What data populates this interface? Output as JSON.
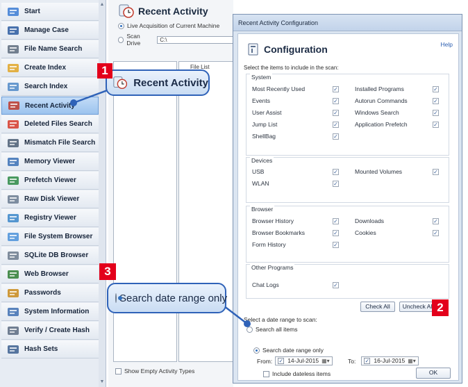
{
  "sidebar": {
    "items": [
      {
        "label": "Start",
        "icon": "start-icon"
      },
      {
        "label": "Manage Case",
        "icon": "case-icon"
      },
      {
        "label": "File Name Search",
        "icon": "binoculars-icon"
      },
      {
        "label": "Create Index",
        "icon": "index-icon"
      },
      {
        "label": "Search Index",
        "icon": "search-index-icon"
      },
      {
        "label": "Recent Activity",
        "icon": "recent-activity-icon"
      },
      {
        "label": "Deleted Files Search",
        "icon": "deleted-files-icon"
      },
      {
        "label": "Mismatch File Search",
        "icon": "mismatch-icon"
      },
      {
        "label": "Memory Viewer",
        "icon": "memory-icon"
      },
      {
        "label": "Prefetch Viewer",
        "icon": "prefetch-icon"
      },
      {
        "label": "Raw Disk Viewer",
        "icon": "disk-icon"
      },
      {
        "label": "Registry Viewer",
        "icon": "registry-icon"
      },
      {
        "label": "File System Browser",
        "icon": "folder-icon"
      },
      {
        "label": "SQLite DB Browser",
        "icon": "database-icon"
      },
      {
        "label": "Web Browser",
        "icon": "globe-icon"
      },
      {
        "label": "Passwords",
        "icon": "key-icon"
      },
      {
        "label": "System Information",
        "icon": "system-info-icon"
      },
      {
        "label": "Verify / Create Hash",
        "icon": "hash-icon"
      },
      {
        "label": "Hash Sets",
        "icon": "hash-sets-icon"
      }
    ],
    "active_index": 5
  },
  "main": {
    "title": "Recent Activity",
    "option_live": "Live Acquisition of Current Machine",
    "option_scan": "Scan Drive",
    "drive_value": "C:\\",
    "file_list_label": "File List",
    "show_empty_label": "Show Empty Activity Types"
  },
  "dialog": {
    "window_title": "Recent Activity Configuration",
    "heading": "Configuration",
    "help_link": "Help",
    "select_items_text": "Select the items to include in the scan:",
    "groups": {
      "system": {
        "label": "System",
        "left": [
          {
            "label": "Most Recently Used",
            "checked": true
          },
          {
            "label": "Events",
            "checked": true
          },
          {
            "label": "User Assist",
            "checked": true
          },
          {
            "label": "Jump List",
            "checked": true
          },
          {
            "label": "ShellBag",
            "checked": true
          }
        ],
        "right": [
          {
            "label": "Installed Programs",
            "checked": true
          },
          {
            "label": "Autorun Commands",
            "checked": true
          },
          {
            "label": "Windows Search",
            "checked": true
          },
          {
            "label": "Application Prefetch",
            "checked": true
          }
        ]
      },
      "devices": {
        "label": "Devices",
        "left": [
          {
            "label": "USB",
            "checked": true
          },
          {
            "label": "WLAN",
            "checked": true
          }
        ],
        "right": [
          {
            "label": "Mounted Volumes",
            "checked": true
          }
        ]
      },
      "browser": {
        "label": "Browser",
        "left": [
          {
            "label": "Browser History",
            "checked": true
          },
          {
            "label": "Browser Bookmarks",
            "checked": true
          },
          {
            "label": "Form History",
            "checked": true
          }
        ],
        "right": [
          {
            "label": "Downloads",
            "checked": true
          },
          {
            "label": "Cookies",
            "checked": true
          }
        ]
      },
      "other": {
        "label": "Other Programs",
        "left": [
          {
            "label": "Chat Logs",
            "checked": true
          }
        ]
      }
    },
    "check_all": "Check All",
    "uncheck_all": "Uncheck All",
    "range_text": "Select a date range to scan:",
    "search_all": "Search all items",
    "search_range": "Search date range only",
    "from_label": "From:",
    "from_date": "14-Jul-2015",
    "to_label": "To:",
    "to_date": "16-Jul-2015",
    "include_dateless": "Include dateless items",
    "ok": "OK"
  },
  "callouts": {
    "badge1": "1",
    "badge2": "2",
    "badge3": "3",
    "zoom1_text": "Recent Activity",
    "zoom3_text": "Search date range only"
  },
  "colors": {
    "badge": "#e3001b",
    "callout_border": "#2f62b8",
    "check": "#3a5f99"
  }
}
